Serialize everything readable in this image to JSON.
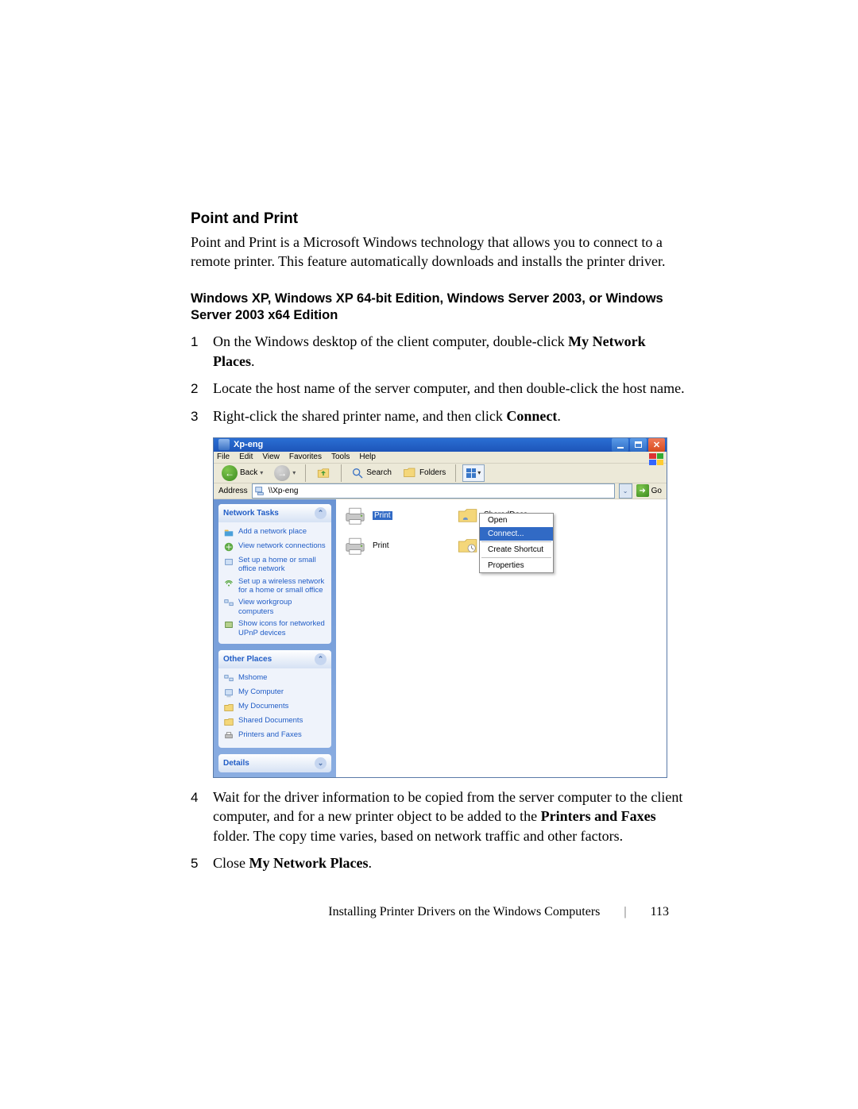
{
  "heading": "Point and Print",
  "intro": "Point and Print is a Microsoft Windows technology that allows you to connect to a remote printer. This feature automatically downloads and installs the printer driver.",
  "subheading": "Windows XP, Windows XP 64-bit Edition, Windows Server 2003, or Windows Server 2003 x64 Edition",
  "step1_pre": "On the Windows desktop of the client computer, double-click ",
  "step1_bold": "My Network Places",
  "step1_post": ".",
  "step2": "Locate the host name of the server computer, and then double-click the host name.",
  "step3_pre": "Right-click the shared printer name, and then click ",
  "step3_bold": "Connect",
  "step3_post": ".",
  "step4_pre": "Wait for the driver information to be copied from the server computer to the client computer, and for a new printer object to be added to the ",
  "step4_bold": "Printers and Faxes",
  "step4_post": " folder. The copy time varies, based on network traffic and other factors.",
  "step5_pre": "Close ",
  "step5_bold": "My Network Places",
  "step5_post": ".",
  "window": {
    "title": "Xp-eng",
    "menu": {
      "file": "File",
      "edit": "Edit",
      "view": "View",
      "favorites": "Favorites",
      "tools": "Tools",
      "help": "Help"
    },
    "toolbar": {
      "back": "Back",
      "search": "Search",
      "folders": "Folders"
    },
    "address": {
      "label": "Address",
      "value": "\\\\Xp-eng",
      "go": "Go"
    },
    "panels": {
      "network": {
        "title": "Network Tasks",
        "items": [
          "Add a network place",
          "View network connections",
          "Set up a home or small office network",
          "Set up a wireless network for a home or small office",
          "View workgroup computers",
          "Show icons for networked UPnP devices"
        ]
      },
      "other": {
        "title": "Other Places",
        "items": [
          "Mshome",
          "My Computer",
          "My Documents",
          "Shared Documents",
          "Printers and Faxes"
        ]
      },
      "details": {
        "title": "Details"
      }
    },
    "content": {
      "printer_label": "Print",
      "shareddocs": "SharedDocs",
      "scheduled": "Scheduled Tasks"
    },
    "contextmenu": {
      "open": "Open",
      "connect": "Connect...",
      "shortcut": "Create Shortcut",
      "properties": "Properties"
    }
  },
  "footer": {
    "chapter": "Installing Printer Drivers on the Windows Computers",
    "page": "113"
  }
}
